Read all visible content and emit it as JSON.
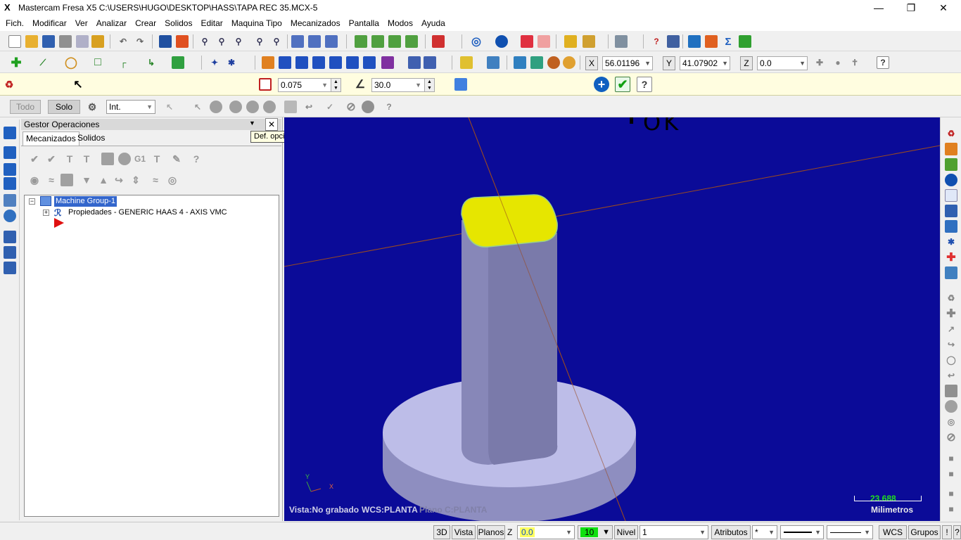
{
  "window": {
    "title": "Mastercam Fresa X5  C:\\USERS\\HUGO\\DESKTOP\\HASS\\TAPA REC 35.MCX-5",
    "logo_text": "X"
  },
  "menu": [
    "Fich.",
    "Modificar",
    "Ver",
    "Analizar",
    "Crear",
    "Solidos",
    "Editar",
    "Maquina Tipo",
    "Mecanizados",
    "Pantalla",
    "Modos",
    "Ayuda"
  ],
  "coords": {
    "x_label": "X",
    "x_value": "56.01196",
    "y_label": "Y",
    "y_value": "41.07902",
    "z_label": "Z",
    "z_value": "0.0"
  },
  "ribbon": {
    "tolerance_value": "0.075",
    "angle_value": "30.0"
  },
  "selection": {
    "all_label": "Todo",
    "only_label": "Solo",
    "mode_value": "Int."
  },
  "ops_manager": {
    "title": "Gestor Operaciones",
    "tabs": [
      "Mecanizados",
      "Solidos"
    ],
    "tree": {
      "group": "Machine Group-1",
      "properties": "Propiedades - GENERIC HAAS 4 - AXIS VMC"
    }
  },
  "tooltip": "Def. opciones, pulse <ENTER>, o OK",
  "annotation": "OK",
  "viewport": {
    "status_left": "Vista:No grabado",
    "status_wcs": "WCS:PLANTA",
    "status_plane": "Plano C:PLANTA",
    "scale_value": "23.688",
    "scale_units": "Milimetros",
    "triad_y": "Y",
    "triad_x": "X"
  },
  "statusbar": {
    "btn_3d": "3D",
    "btn_view": "Vista",
    "btn_planes": "Planos",
    "z_label": "Z",
    "z_value": "0.0",
    "color_value": "10",
    "level_label": "Nivel",
    "level_value": "1",
    "attributes_label": "Atributos",
    "point_style": "*",
    "wcs_label": "WCS",
    "groups_label": "Grupos",
    "excl": "!",
    "help": "?"
  },
  "colors": {
    "viewport_bg": "#0b0b98",
    "top_face": "#e6e600",
    "body": "#8c8cb4",
    "disk": "#b8b8e0"
  }
}
